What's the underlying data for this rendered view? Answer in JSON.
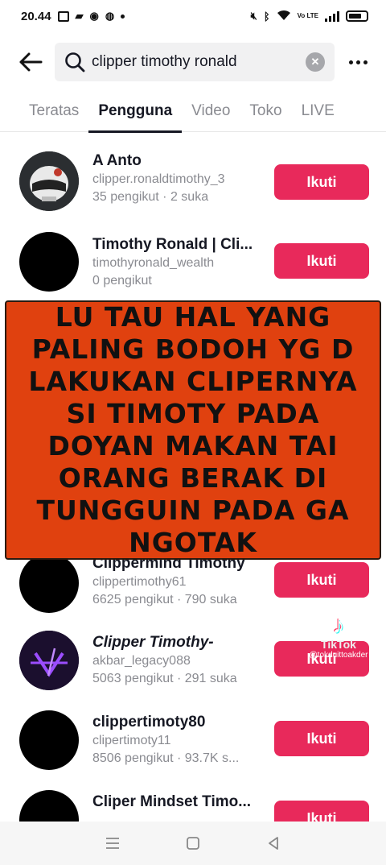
{
  "status_bar": {
    "time": "20.44",
    "net_label": "Vo LTE"
  },
  "search": {
    "query": "clipper timothy ronald",
    "back_icon": "arrow-left-icon",
    "search_icon": "search-icon",
    "clear_icon": "clear-icon",
    "more_icon": "more-icon"
  },
  "tabs": [
    {
      "label": "Teratas",
      "active": false
    },
    {
      "label": "Pengguna",
      "active": true
    },
    {
      "label": "Video",
      "active": false
    },
    {
      "label": "Toko",
      "active": false
    },
    {
      "label": "LIVE",
      "active": false
    }
  ],
  "users": [
    {
      "name": "A Anto",
      "handle": "clipper.ronaldtimothy_3",
      "stats": "35 pengikut · 2 suka",
      "follow": "Ikuti",
      "avatar": "helmet-avatar"
    },
    {
      "name": "Timothy Ronald | Cli...",
      "handle": "timothyronald_wealth",
      "stats": "0 pengikut",
      "follow": "Ikuti",
      "avatar": "black-avatar"
    },
    {
      "name": "Clippermind Timothy",
      "handle": "clippertimothy61",
      "stats": "6625 pengikut · 790 suka",
      "follow": "Ikuti",
      "avatar": "black-avatar"
    },
    {
      "name": "Clipper Timothy-",
      "handle": "akbar_legacy088",
      "stats": "5063 pengikut · 291 suka",
      "follow": "Ikuti",
      "avatar": "purple-logo-avatar"
    },
    {
      "name": "clippertimoty80",
      "handle": "clipertimoty11",
      "stats": "8506 pengikut · 93.7K s...",
      "follow": "Ikuti",
      "avatar": "black-avatar"
    },
    {
      "name": "Cliper Mindset Timo...",
      "handle": "",
      "stats": "",
      "follow": "Ikuti",
      "avatar": "black-avatar"
    }
  ],
  "overlay": {
    "text": "LU TAU HAL YANG PALING BODOH YG D LAKUKAN CLIPERNYA SI TIMOTY PADA DOYAN MAKAN TAI ORANG BERAK DI TUNGGUIN PADA GA NGOTAK"
  },
  "watermark": {
    "brand": "TikTok",
    "handle": "@tokduittoakder"
  },
  "colors": {
    "accent": "#e8295b",
    "overlay_bg": "#e0410f"
  }
}
